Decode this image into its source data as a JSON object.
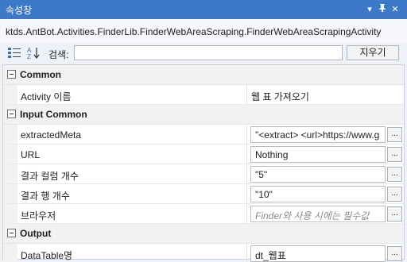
{
  "panel": {
    "title": "속성창",
    "buttons": {
      "menu": "▾",
      "pin": "ᵖ",
      "close": "✕"
    }
  },
  "type_name": "ktds.AntBot.Activities.FinderLib.FinderWebAreaScraping.FinderWebAreaScrapingActivity",
  "toolbar": {
    "search_label": "검색:",
    "search_value": "",
    "clear_label": "지우기"
  },
  "categories": [
    {
      "name": "Common",
      "properties": [
        {
          "name": "Activity 이름",
          "value": "웹 표 가져오기"
        }
      ]
    },
    {
      "name": "Input Common",
      "properties": [
        {
          "name": "extractedMeta",
          "value": "\"<extract> <url>https://www.g"
        },
        {
          "name": "URL",
          "value": "Nothing"
        },
        {
          "name": "결과 컬럼 개수",
          "value": "\"5\""
        },
        {
          "name": "결과 행 개수",
          "value": "\"10\""
        },
        {
          "name": "브라우저",
          "value": "Finder와 사용 시에는 필수값"
        }
      ]
    },
    {
      "name": "Output",
      "properties": [
        {
          "name": "DataTable명",
          "value": "dt_웹표"
        }
      ]
    }
  ],
  "ellipsis_label": "...",
  "colors": {
    "title_bar": "#3e78c8",
    "background": "#eef2f8"
  },
  "icons": {
    "categorized": "categorized-sort-icon",
    "alphabetical": "alphabetical-sort-icon"
  }
}
